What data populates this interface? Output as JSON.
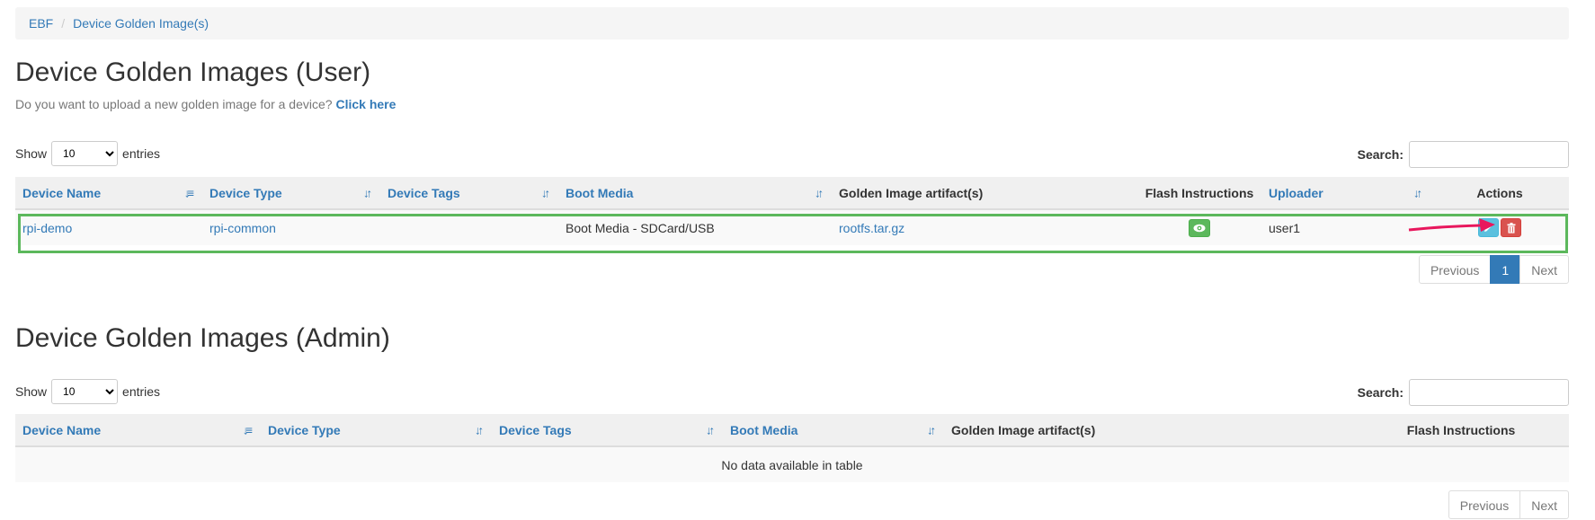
{
  "breadcrumb": {
    "root": "EBF",
    "separator": "/",
    "current": "Device Golden Image(s)"
  },
  "user_section": {
    "title": "Device Golden Images (User)",
    "upload_prompt": "Do you want to upload a new golden image for a device?",
    "upload_link": "Click here",
    "length": {
      "show": "Show",
      "selected": "10",
      "entries": "entries"
    },
    "search_label": "Search:",
    "columns": [
      "Device Name",
      "Device Type",
      "Device Tags",
      "Boot Media",
      "Golden Image artifact(s)",
      "Flash Instructions",
      "Uploader",
      "Actions"
    ],
    "rows": [
      {
        "device_name": "rpi-demo",
        "device_type": "rpi-common",
        "device_tags": "",
        "boot_media": "Boot Media - SDCard/USB",
        "artifact": "rootfs.tar.gz",
        "uploader": "user1"
      }
    ],
    "pagination": {
      "previous": "Previous",
      "page": "1",
      "next": "Next"
    }
  },
  "admin_section": {
    "title": "Device Golden Images (Admin)",
    "length": {
      "show": "Show",
      "selected": "10",
      "entries": "entries"
    },
    "search_label": "Search:",
    "columns": [
      "Device Name",
      "Device Type",
      "Device Tags",
      "Boot Media",
      "Golden Image artifact(s)",
      "Flash Instructions"
    ],
    "empty_message": "No data available in table",
    "pagination": {
      "previous": "Previous",
      "next": "Next"
    }
  },
  "icons": {
    "eye": "eye-icon",
    "edit": "pencil-icon",
    "delete": "trash-icon",
    "sort": "sort-icon",
    "sort_asc": "sort-asc-icon"
  },
  "colors": {
    "link": "#337ab7",
    "success": "#5cb85c",
    "info": "#5bc0de",
    "danger": "#d9534f",
    "annotation_arrow": "#e8175d",
    "highlight_box": "#5cb85c"
  }
}
